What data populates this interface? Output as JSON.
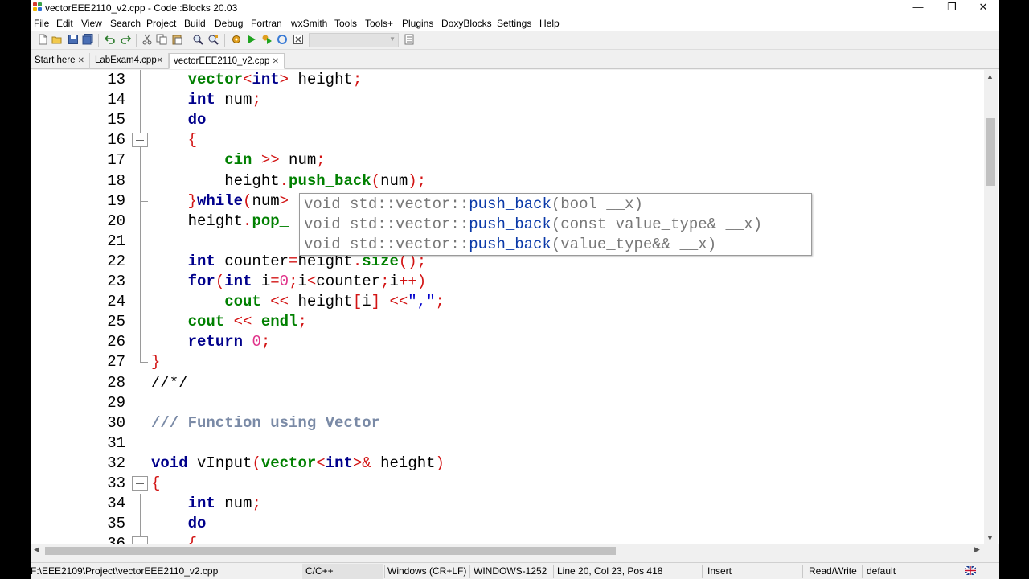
{
  "window": {
    "title": "vectorEEE2110_v2.cpp - Code::Blocks 20.03",
    "controls": {
      "minimize": "—",
      "restore": "❐",
      "close": "✕"
    }
  },
  "menubar": [
    "File",
    "Edit",
    "View",
    "Search",
    "Project",
    "Build",
    "Debug",
    "Fortran",
    "wxSmith",
    "Tools",
    "Tools+",
    "Plugins",
    "DoxyBlocks",
    "Settings",
    "Help"
  ],
  "tabs": [
    {
      "label": "Start here",
      "close": "✕",
      "active": false
    },
    {
      "label": "LabExam4.cpp",
      "close": "✕",
      "active": false
    },
    {
      "label": "vectorEEE2110_v2.cpp",
      "close": "✕",
      "active": true
    }
  ],
  "editor": {
    "line_numbers": [
      "13",
      "14",
      "15",
      "16",
      "17",
      "18",
      "19",
      "20",
      "21",
      "22",
      "23",
      "24",
      "25",
      "26",
      "27",
      "28",
      "29",
      "30",
      "31",
      "32",
      "33",
      "34",
      "35",
      "36"
    ],
    "lines": [
      [
        [
          "    ",
          "plain"
        ],
        [
          "vector",
          "fn"
        ],
        [
          "<",
          "op"
        ],
        [
          "int",
          "ty"
        ],
        [
          "> ",
          "op"
        ],
        [
          "height",
          "plain"
        ],
        [
          ";",
          "op"
        ]
      ],
      [
        [
          "    ",
          "plain"
        ],
        [
          "int",
          "ty"
        ],
        [
          " num",
          "plain"
        ],
        [
          ";",
          "op"
        ]
      ],
      [
        [
          "    ",
          "plain"
        ],
        [
          "do",
          "kw"
        ]
      ],
      [
        [
          "    ",
          "plain"
        ],
        [
          "{",
          "op"
        ]
      ],
      [
        [
          "        ",
          "plain"
        ],
        [
          "cin",
          "fn"
        ],
        [
          " >> ",
          "op"
        ],
        [
          "num",
          "plain"
        ],
        [
          ";",
          "op"
        ]
      ],
      [
        [
          "        ",
          "plain"
        ],
        [
          "height",
          "plain"
        ],
        [
          ".",
          "op"
        ],
        [
          "push_back",
          "fn"
        ],
        [
          "(",
          "op"
        ],
        [
          "num",
          "plain"
        ],
        [
          ");",
          "op"
        ]
      ],
      [
        [
          "    ",
          "plain"
        ],
        [
          "}",
          "op"
        ],
        [
          "while",
          "kw"
        ],
        [
          "(",
          "op"
        ],
        [
          "num",
          "plain"
        ],
        [
          ">",
          "op"
        ]
      ],
      [
        [
          "    ",
          "plain"
        ],
        [
          "height",
          "plain"
        ],
        [
          ".",
          "op"
        ],
        [
          "pop_",
          "fn"
        ]
      ],
      [
        [
          "",
          "plain"
        ]
      ],
      [
        [
          "    ",
          "plain"
        ],
        [
          "int",
          "ty"
        ],
        [
          " counter",
          "plain"
        ],
        [
          "=",
          "op"
        ],
        [
          "height",
          "plain"
        ],
        [
          ".",
          "op"
        ],
        [
          "size",
          "fn"
        ],
        [
          "();",
          "op"
        ]
      ],
      [
        [
          "    ",
          "plain"
        ],
        [
          "for",
          "kw"
        ],
        [
          "(",
          "op"
        ],
        [
          "int",
          "ty"
        ],
        [
          " i",
          "plain"
        ],
        [
          "=",
          "op"
        ],
        [
          "0",
          "num"
        ],
        [
          ";",
          "op"
        ],
        [
          "i",
          "plain"
        ],
        [
          "<",
          "op"
        ],
        [
          "counter",
          "plain"
        ],
        [
          ";",
          "op"
        ],
        [
          "i",
          "plain"
        ],
        [
          "++)",
          "op"
        ]
      ],
      [
        [
          "        ",
          "plain"
        ],
        [
          "cout",
          "fn"
        ],
        [
          " << ",
          "op"
        ],
        [
          "height",
          "plain"
        ],
        [
          "[",
          "op"
        ],
        [
          "i",
          "plain"
        ],
        [
          "] ",
          "op"
        ],
        [
          "<<",
          "op"
        ],
        [
          "\",\"",
          "str"
        ],
        [
          ";",
          "op"
        ]
      ],
      [
        [
          "    ",
          "plain"
        ],
        [
          "cout",
          "fn"
        ],
        [
          " << ",
          "op"
        ],
        [
          "endl",
          "fn"
        ],
        [
          ";",
          "op"
        ]
      ],
      [
        [
          "    ",
          "plain"
        ],
        [
          "return",
          "kw"
        ],
        [
          " ",
          "plain"
        ],
        [
          "0",
          "num"
        ],
        [
          ";",
          "op"
        ]
      ],
      [
        [
          "}",
          "op"
        ]
      ],
      [
        [
          "//*/",
          "plain"
        ]
      ],
      [
        [
          "",
          "plain"
        ]
      ],
      [
        [
          "/// Function using Vector",
          "cmt"
        ]
      ],
      [
        [
          "",
          "plain"
        ]
      ],
      [
        [
          "void",
          "kw"
        ],
        [
          " vInput",
          "plain"
        ],
        [
          "(",
          "op"
        ],
        [
          "vector",
          "fn"
        ],
        [
          "<",
          "op"
        ],
        [
          "int",
          "ty"
        ],
        [
          ">& ",
          "op"
        ],
        [
          "height",
          "plain"
        ],
        [
          ")",
          "op"
        ]
      ],
      [
        [
          "{",
          "op"
        ]
      ],
      [
        [
          "    ",
          "plain"
        ],
        [
          "int",
          "ty"
        ],
        [
          " num",
          "plain"
        ],
        [
          ";",
          "op"
        ]
      ],
      [
        [
          "    ",
          "plain"
        ],
        [
          "do",
          "kw"
        ]
      ],
      [
        [
          "    ",
          "plain"
        ],
        [
          "{",
          "op"
        ]
      ]
    ],
    "calltip": [
      [
        "void std::vector::",
        "push_back",
        "(bool __x)"
      ],
      [
        "void std::vector::",
        "push_back",
        "(const value_type& __x)"
      ],
      [
        "void std::vector::",
        "push_back",
        "(value_type&& __x)"
      ]
    ]
  },
  "statusbar": {
    "path": "F:\\EEE2109\\Project\\vectorEEE2110_v2.cpp",
    "language": "C/C++",
    "line_endings": "Windows (CR+LF)",
    "encoding": "WINDOWS-1252",
    "position": "Line 20, Col 23, Pos 418",
    "mode": "Insert",
    "access": "Read/Write",
    "profile": "default"
  }
}
